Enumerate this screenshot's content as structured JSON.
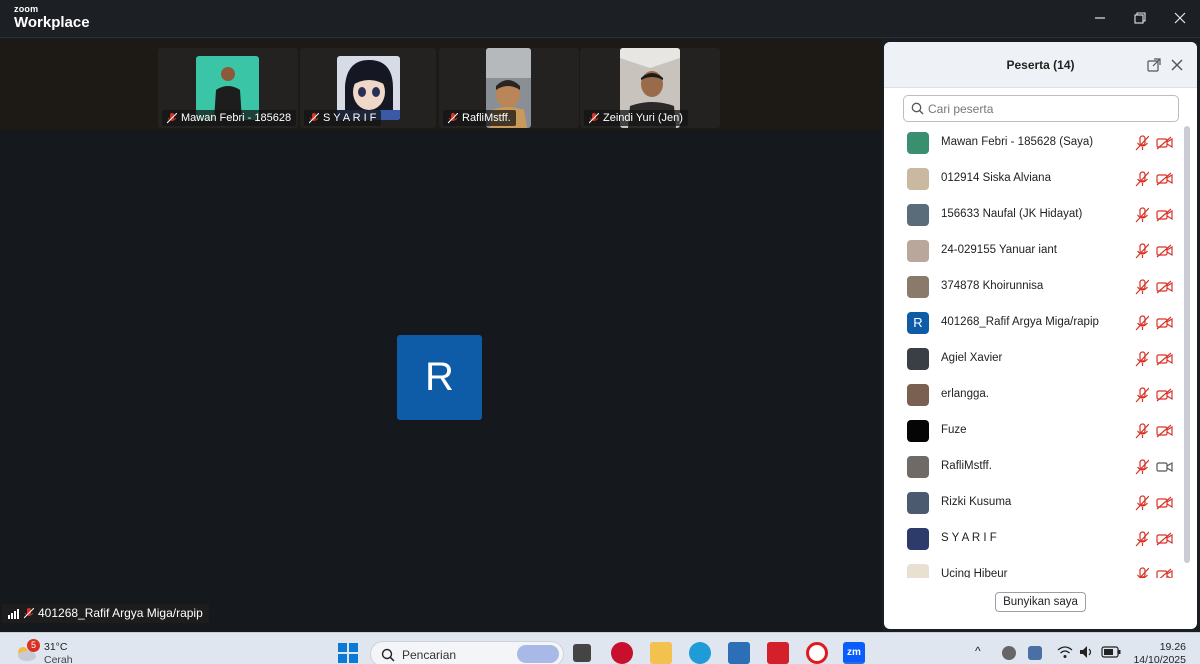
{
  "app": {
    "brand_small": "zoom",
    "brand_big": "Workplace"
  },
  "gallery": [
    {
      "name": "Mawan Febri - 185628",
      "bg": "#39c5a6",
      "shirt": "#1d1d1d",
      "skin": "#8a5a3a"
    },
    {
      "name": "S Y A R I F",
      "bg": "#d7dbe6",
      "shirt": "#2d3b6a",
      "skin": "#f0d8c8"
    },
    {
      "name": "RafliMstff.",
      "bg": "#8a8f96",
      "shirt": "#c99a5a",
      "skin": "#b98559"
    },
    {
      "name": "Zeindi Yuri (Jen)",
      "bg": "#c8c4bd",
      "shirt": "#2c2a28",
      "skin": "#9a6b4b"
    }
  ],
  "active_speaker": {
    "initial": "R",
    "name": "401268_Rafif Argya Miga/rapip",
    "color": "#0e5ca8"
  },
  "panel": {
    "title": "Peserta (14)",
    "search_placeholder": "Cari peserta",
    "unmute_label": "Bunyikan saya",
    "participants": [
      {
        "name": "Mawan Febri - 185628 (Saya)",
        "avatar": "#3a8f6e",
        "mic": "muted",
        "cam": "off"
      },
      {
        "name": "012914 Siska Alviana",
        "avatar": "#c9b9a0",
        "mic": "muted",
        "cam": "off"
      },
      {
        "name": "156633 Naufal (JK Hidayat)",
        "avatar": "#5a6b7a",
        "mic": "muted",
        "cam": "off"
      },
      {
        "name": "24-029155 Yanuar iant",
        "avatar": "#b8a79a",
        "mic": "muted",
        "cam": "off"
      },
      {
        "name": "374878 Khoirunnisa",
        "avatar": "#8a7a6a",
        "mic": "muted",
        "cam": "off"
      },
      {
        "name": "401268_Rafif Argya Miga/rapip",
        "avatar": "#0e5ca8",
        "initial": "R",
        "mic": "muted",
        "cam": "off"
      },
      {
        "name": "Agiel Xavier",
        "avatar": "#3a3f46",
        "mic": "muted",
        "cam": "off"
      },
      {
        "name": "erlangga.",
        "avatar": "#7a6050",
        "mic": "muted",
        "cam": "off"
      },
      {
        "name": "Fuze",
        "avatar": "#050505",
        "mic": "muted",
        "cam": "off"
      },
      {
        "name": "RafliMstff.",
        "avatar": "#6f6a66",
        "mic": "muted",
        "cam": "on"
      },
      {
        "name": "Rizki Kusuma",
        "avatar": "#4b5a6e",
        "mic": "muted",
        "cam": "off"
      },
      {
        "name": "S Y A R I F",
        "avatar": "#2d3b6a",
        "mic": "muted",
        "cam": "off"
      },
      {
        "name": "Ucing Hibeur",
        "avatar": "#e8e0d0",
        "mic": "muted",
        "cam": "off"
      }
    ]
  },
  "taskbar": {
    "weather_badge": "5",
    "temperature": "31°C",
    "condition": "Cerah",
    "search_label": "Pencarian",
    "time": "19.26",
    "date": "14/10/2025"
  },
  "colors": {
    "mute_red": "#d93025",
    "accent_blue": "#0e5ca8"
  }
}
